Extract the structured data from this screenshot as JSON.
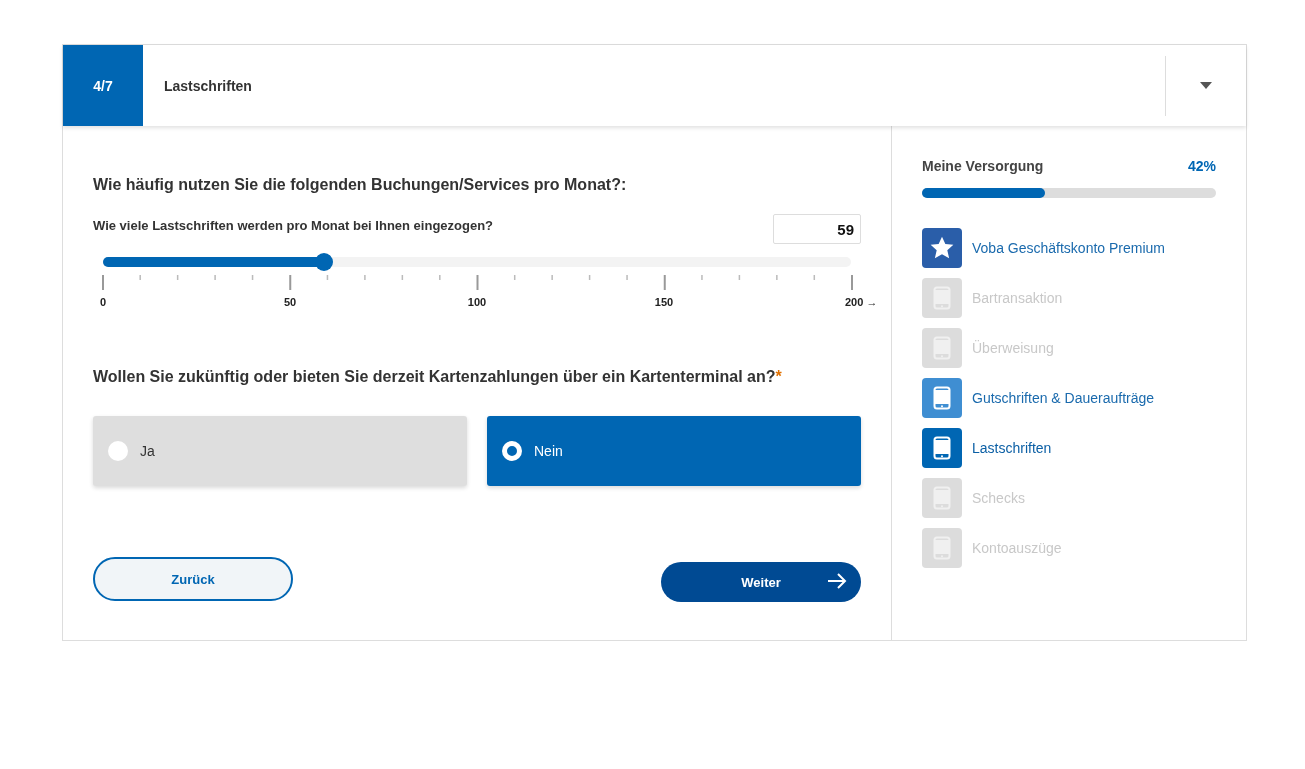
{
  "header": {
    "step": "4/7",
    "title": "Lastschriften"
  },
  "question_group": {
    "title": "Wie häufig nutzen Sie die folgenden Buchungen/Services pro Monat?:"
  },
  "slider_question": {
    "label": "Wie viele Lastschriften werden pro Monat bei Ihnen eingezogen?",
    "value": "59",
    "level": 0.295,
    "scale_labels": [
      "0",
      "50",
      "100",
      "150",
      "200 →"
    ]
  },
  "choice_question": {
    "label": "Wollen Sie zukünftig oder bieten Sie derzeit Kartenzahlungen über ein Kartenterminal an?",
    "required_mark": "*",
    "options": [
      {
        "label": "Ja",
        "selected": false
      },
      {
        "label": "Nein",
        "selected": true
      }
    ]
  },
  "buttons": {
    "back": "Zurück",
    "next": "Weiter"
  },
  "sidebar": {
    "title": "Meine Versorgung",
    "percent": "42%",
    "level": 0.42,
    "items": [
      {
        "label": "Voba Geschäftskonto Premium",
        "kind": "star",
        "completed": true,
        "active": false
      },
      {
        "label": "Bartransaktion",
        "kind": "phone",
        "completed": false,
        "active": false
      },
      {
        "label": "Überweisung",
        "kind": "phone",
        "completed": false,
        "active": false
      },
      {
        "label": "Gutschriften & Daueraufträge",
        "kind": "phone",
        "completed": true,
        "active": false
      },
      {
        "label": "Lastschriften",
        "kind": "phone",
        "completed": false,
        "active": true
      },
      {
        "label": "Schecks",
        "kind": "phone",
        "completed": false,
        "active": false
      },
      {
        "label": "Kontoauszüge",
        "kind": "phone",
        "completed": false,
        "active": false
      }
    ]
  }
}
